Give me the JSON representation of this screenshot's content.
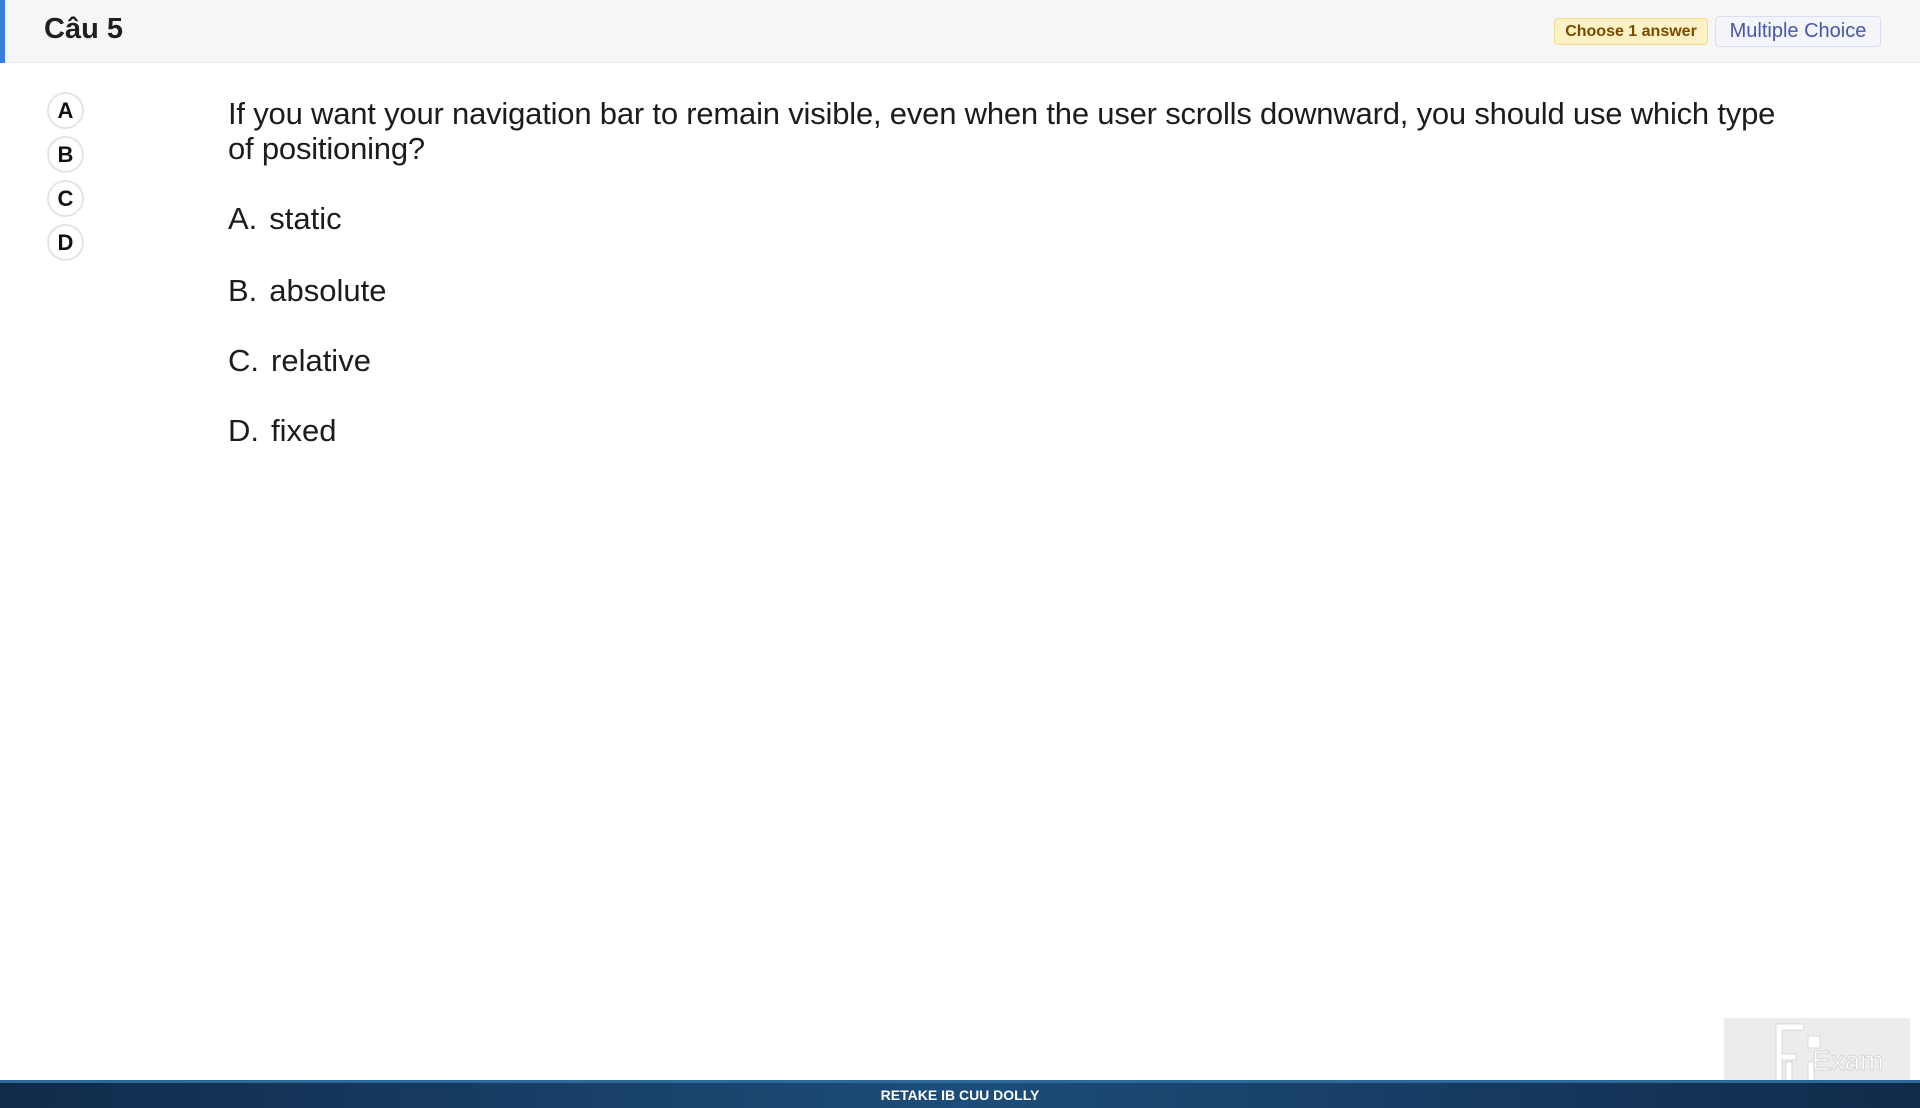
{
  "header": {
    "title": "Câu 5",
    "badge_choose": "Choose 1 answer",
    "badge_type": "Multiple Choice"
  },
  "answer_selector": [
    "A",
    "B",
    "C",
    "D"
  ],
  "question": {
    "text": "If you want your navigation bar to remain visible, even when the user scrolls downward, you should use which type of positioning?",
    "options": [
      {
        "letter": "A.",
        "text": "static"
      },
      {
        "letter": "B.",
        "text": "absolute"
      },
      {
        "letter": "C.",
        "text": "relative"
      },
      {
        "letter": "D.",
        "text": "fixed"
      }
    ]
  },
  "footer": {
    "text": "RETAKE IB CUU DOLLY"
  },
  "logo": {
    "text": "Exam",
    "icon": "fu-exam-logo-icon"
  },
  "colors": {
    "accent": "#3b7ddd",
    "badge_choose_bg": "#fdf1c5",
    "badge_type_text": "#4a56a8",
    "footer_bg": "#1d4d7a"
  }
}
